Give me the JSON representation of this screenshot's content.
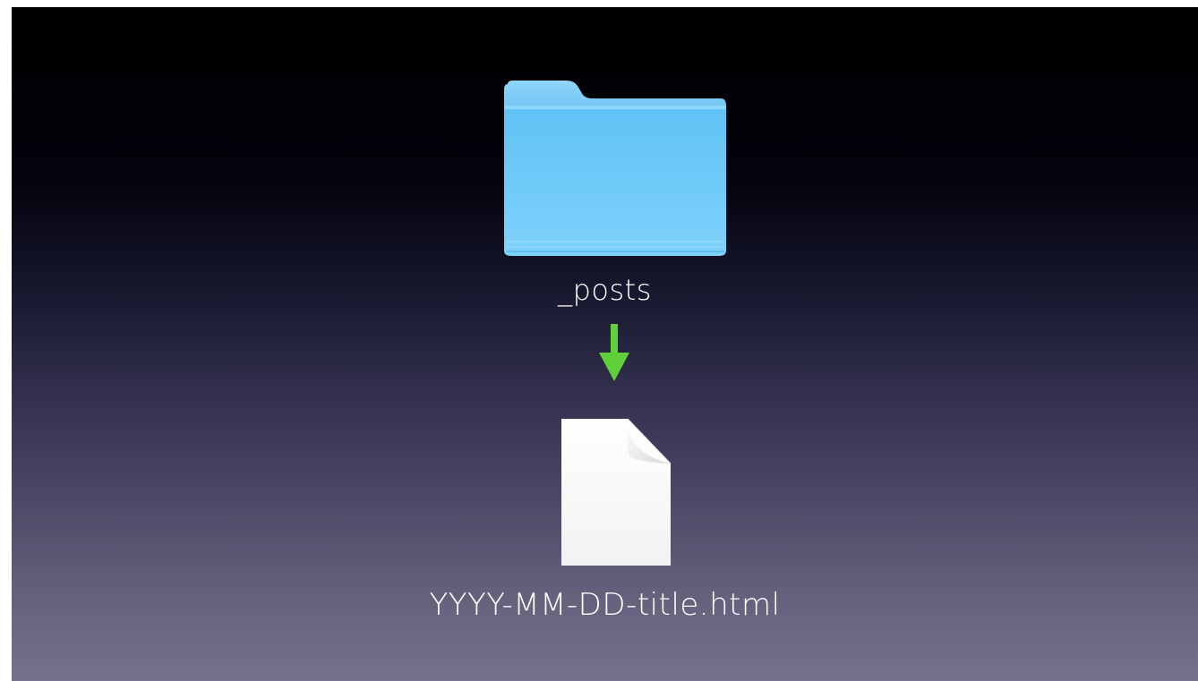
{
  "diagram": {
    "folder": {
      "icon": "folder-icon",
      "label": "_posts",
      "color": "#6cc7f6"
    },
    "connector": {
      "icon": "arrow-down-icon",
      "color": "#5fcf3a"
    },
    "file": {
      "icon": "document-icon",
      "label": "YYYY-MM-DD-title.html"
    }
  }
}
